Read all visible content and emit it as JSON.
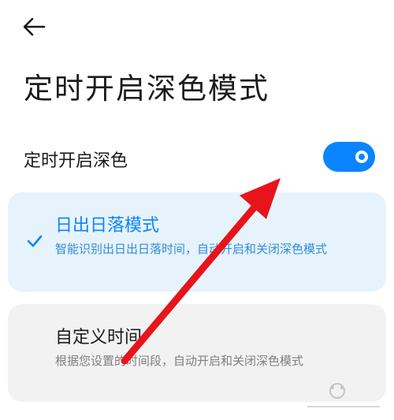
{
  "page": {
    "title": "定时开启深色模式"
  },
  "toggle_row": {
    "label": "定时开启深色",
    "enabled": true
  },
  "options": [
    {
      "title": "日出日落模式",
      "description": "智能识别出日出日落时间，自动开启和关闭深色模式",
      "selected": true
    },
    {
      "title": "自定义时间",
      "description": "根据您设置的时间段，自动开启和关闭深色模式",
      "selected": false
    }
  ],
  "icons": {
    "back": "back-arrow-icon",
    "selected": "checkmark-icon"
  },
  "colors": {
    "accent": "#0a84ff",
    "selected_card_bg": "#e7f3fc",
    "card_bg": "#f2f2f2",
    "annotation_arrow": "#e8141b"
  }
}
